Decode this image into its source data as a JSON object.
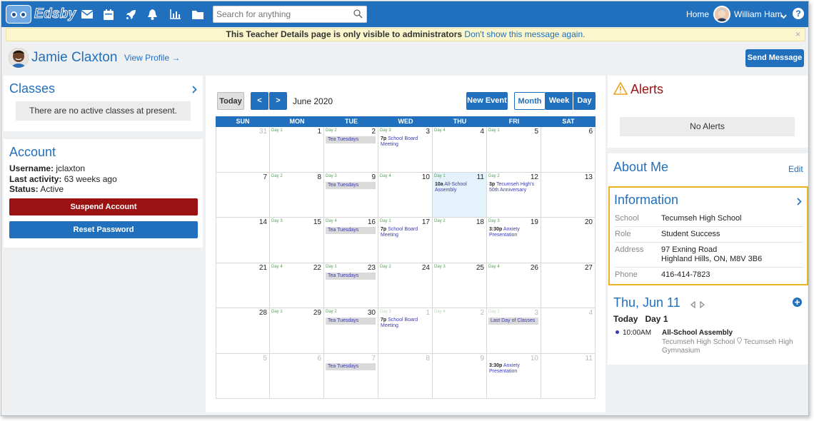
{
  "app": {
    "name": "Edsby",
    "search_placeholder": "Search for anything",
    "home_label": "Home",
    "user_name": "William Ham",
    "help_label": "?"
  },
  "nav": {
    "icons": [
      "mail-icon",
      "calendar-icon",
      "rocket-icon",
      "bell-icon",
      "chart-icon",
      "folder-icon"
    ]
  },
  "banner": {
    "text": "This Teacher Details page is only visible to administrators",
    "link": "Don't show this message again.",
    "close": "×"
  },
  "profile": {
    "name": "Jamie Claxton",
    "view_profile": "View Profile →",
    "send_message": "Send Message"
  },
  "classes": {
    "title": "Classes",
    "empty": "There are no active classes at present."
  },
  "account": {
    "title": "Account",
    "username_label": "Username:",
    "username": "jclaxton",
    "activity_label": "Last activity:",
    "activity": "63 weeks ago",
    "status_label": "Status:",
    "status": "Active",
    "suspend": "Suspend Account",
    "reset": "Reset Password"
  },
  "calendar": {
    "today": "Today",
    "prev": "<",
    "next": ">",
    "month_title": "June 2020",
    "new_event": "New Event",
    "views": [
      "Month",
      "Week",
      "Day"
    ],
    "active_view": "Month",
    "days": [
      "SUN",
      "MON",
      "TUE",
      "WED",
      "THU",
      "FRI",
      "SAT"
    ],
    "weeks": [
      [
        {
          "n": "31",
          "dim": true
        },
        {
          "n": "1",
          "d": "Day 1"
        },
        {
          "n": "2",
          "d": "Day 2",
          "ev": [
            {
              "bar": "Tea Tuesdays"
            }
          ]
        },
        {
          "n": "3",
          "d": "Day 3",
          "ev": [
            {
              "t": "7p",
              "x": "School Board Meeting"
            }
          ]
        },
        {
          "n": "4",
          "d": "Day 4"
        },
        {
          "n": "5",
          "d": "Day 1"
        },
        {
          "n": "6"
        }
      ],
      [
        {
          "n": "7"
        },
        {
          "n": "8",
          "d": "Day 2"
        },
        {
          "n": "9",
          "d": "Day 3",
          "ev": [
            {
              "bar": "Tea Tuesdays"
            }
          ]
        },
        {
          "n": "10",
          "d": "Day 4"
        },
        {
          "n": "11",
          "d": "Day 1",
          "hl": true,
          "ev": [
            {
              "t": "10a",
              "x": "All-School Assembly"
            }
          ]
        },
        {
          "n": "12",
          "d": "Day 2",
          "ev": [
            {
              "t": "3p",
              "x": "Tecumseh High's 50th Anniversary"
            }
          ]
        },
        {
          "n": "13"
        }
      ],
      [
        {
          "n": "14"
        },
        {
          "n": "15",
          "d": "Day 3"
        },
        {
          "n": "16",
          "d": "Day 4",
          "ev": [
            {
              "bar": "Tea Tuesdays"
            }
          ]
        },
        {
          "n": "17",
          "d": "Day 1",
          "ev": [
            {
              "t": "7p",
              "x": "School Board Meeting"
            }
          ]
        },
        {
          "n": "18",
          "d": "Day 2"
        },
        {
          "n": "19",
          "d": "Day 3",
          "ev": [
            {
              "t": "3:30p",
              "x": "Anxiety Presentation"
            }
          ]
        },
        {
          "n": "20"
        }
      ],
      [
        {
          "n": "21"
        },
        {
          "n": "22",
          "d": "Day 4"
        },
        {
          "n": "23",
          "d": "Day 1",
          "ev": [
            {
              "bar": "Tea Tuesdays"
            }
          ]
        },
        {
          "n": "24",
          "d": "Day 2"
        },
        {
          "n": "25",
          "d": "Day 3"
        },
        {
          "n": "26",
          "d": "Day 4"
        },
        {
          "n": "27"
        }
      ],
      [
        {
          "n": "28"
        },
        {
          "n": "29",
          "d": "Day 1"
        },
        {
          "n": "30",
          "d": "Day 2",
          "ev": [
            {
              "bar": "Tea Tuesdays"
            }
          ]
        },
        {
          "n": "1",
          "dim": true,
          "d": "Day 3",
          "ev": [
            {
              "t": "7p",
              "x": "School Board Meeting"
            }
          ]
        },
        {
          "n": "2",
          "dim": true,
          "d": "Day 4"
        },
        {
          "n": "3",
          "dim": true,
          "d": "Day 1",
          "ev": [
            {
              "bar": "Last Day of Classes"
            }
          ]
        },
        {
          "n": "4",
          "dim": true
        }
      ],
      [
        {
          "n": "5",
          "dim": true
        },
        {
          "n": "6",
          "dim": true
        },
        {
          "n": "7",
          "dim": true,
          "ev": [
            {
              "bar": "Tea Tuesdays"
            }
          ]
        },
        {
          "n": "8",
          "dim": true
        },
        {
          "n": "9",
          "dim": true
        },
        {
          "n": "10",
          "dim": true,
          "ev": [
            {
              "t": "3:30p",
              "x": "Anxiety Presentation"
            }
          ]
        },
        {
          "n": "11",
          "dim": true
        }
      ]
    ]
  },
  "alerts": {
    "title": "Alerts",
    "empty": "No Alerts"
  },
  "about": {
    "title": "About Me",
    "edit": "Edit"
  },
  "information": {
    "title": "Information",
    "rows": [
      {
        "label": "School",
        "value": "Tecumseh High School"
      },
      {
        "label": "Role",
        "value": "Student Success"
      },
      {
        "label": "Address",
        "value": "97 Exning Road",
        "value2": "Highland Hills, ON, M8V 3B6"
      },
      {
        "label": "Phone",
        "value": "416-414-7823"
      }
    ]
  },
  "day_view": {
    "title": "Thu, Jun 11",
    "today": "Today",
    "day": "Day 1",
    "event_time": "10:00AM",
    "event_title": "All-School Assembly",
    "location1": "Tecumseh High School",
    "location2": "Tecumseh High",
    "location3": "Gymnasium"
  },
  "colors": {
    "primary": "#2170be",
    "danger": "#9b1212",
    "highlight": "#e8b41e",
    "banner": "#fbf6cb"
  }
}
